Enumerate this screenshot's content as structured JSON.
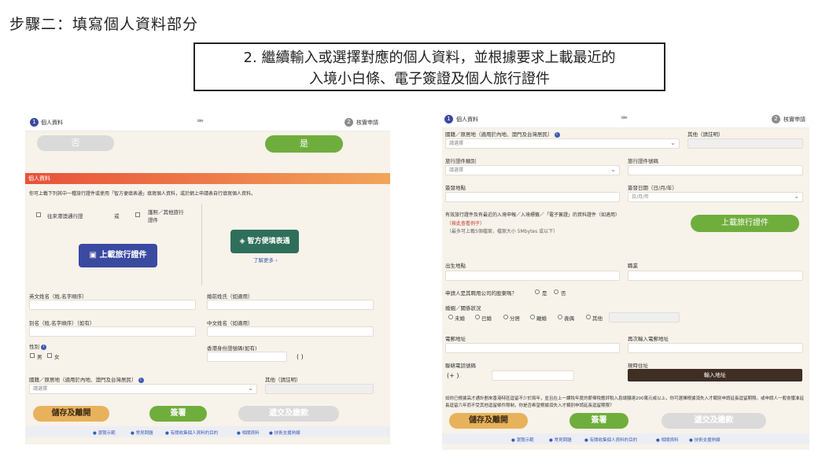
{
  "heading": "步驟二：填寫個人資料部分",
  "callout": {
    "line1": "2. 繼續輸入或選擇對應的個人資料，並根據要求上載最近的",
    "line2": "入境小白條、電子簽證及個人旅行證件"
  },
  "left": {
    "step1": "個人資料",
    "step2": "核實申請",
    "chevrons": "»»",
    "no_label": "否",
    "yes_label": "是",
    "banner": "個人資料",
    "intro": "你可上載下列其中一種旅行證件或使用「智方便填表通」填寫個人資料，或於網上申請表自行填寫個人資料。",
    "opt1": "往來港澳通行證",
    "or": "或",
    "opt2a": "護照／其他旅行",
    "opt2b": "證件",
    "upload_btn": "上載旅行證件",
    "iamsmart_btn": "智方便填表通",
    "learn_more": "了解更多 ›",
    "f_eng_name": "英文姓名（姓,名字順序）",
    "f_maiden": "婚前姓氏（如適用）",
    "f_alias": "別名（姓,名字順序）（如有）",
    "f_chi_name": "中文姓名（如適用）",
    "f_sex": "性別",
    "sex_m": "男",
    "sex_f": "女",
    "f_hkid": "香港身份證號碼(如有)",
    "hkid_paren": "(        )",
    "f_nationality": "國籍／原居地（適用於內地、澳門及台灣居民）",
    "f_other": "其他（請註明）",
    "select_ph": "請選擇",
    "btn_save": "儲存及離開",
    "btn_sign": "簽署",
    "btn_submit": "遞交及繳款",
    "footer": [
      "瀏覽示範",
      "常見問題",
      "有關收集個人資料的目的",
      "相關資料",
      "技術支援熱線"
    ]
  },
  "right": {
    "step1": "個人資料",
    "step2": "核實申請",
    "chevrons": "»»",
    "f_nationality": "國籍／原居地（適用於內地、澳門及台灣居民）",
    "f_other": "其他（請註明）",
    "select_ph": "請選擇",
    "f_doc_type": "旅行證件類別",
    "f_doc_no": "旅行證件號碼",
    "f_issue_place": "簽發地點",
    "f_issue_date": "簽發日期（日/月/年）",
    "date_ph": "日/月/年",
    "f_upload_desc": "有效旅行證件及有最近的入境申報／入境標籤／「電子簽證」的資料證件（如適用）",
    "upload_note1": "（按此查看例子）",
    "upload_note2": "（最多可上載5個檔案，檔案大小 5Mbytes 或以下）",
    "upload_btn": "上載旅行證件",
    "f_birth_place": "出生地點",
    "f_occupation": "職業",
    "f_employee_q": "申請人是其聘用公司的股東嗎？",
    "yes": "是",
    "no": "否",
    "f_marital": "婚姻／關係狀況",
    "marital": [
      "未婚",
      "已婚",
      "分居",
      "離婚",
      "喪偶",
      "其他"
    ],
    "f_email": "電郵地址",
    "f_email2": "再次輸入電郵地址",
    "f_phone": "聯絡電話號碼",
    "phone_prefix": "(+        )",
    "f_address": "現時住址",
    "address_btn": "輸入地址",
    "note": "如你已根據高才通計劃來香港特區逗留不少於兩年，並且在上一課稅年度的薪俸稅應評稅入息總額達200萬元或以上，你可選擇根據須失入才類別申請延長逗留期限。或申請人一般會獲准延長逗留六年而不受其他逗留條件限制，你是否希望根據須失入才類別申請延長逗留期限？",
    "btn_save": "儲存及離開",
    "btn_sign": "簽署",
    "btn_submit": "遞交及繳款",
    "footer": [
      "瀏覽示範",
      "常見問題",
      "有關收集個人資料的目的",
      "相關資料",
      "技術支援熱線"
    ]
  }
}
